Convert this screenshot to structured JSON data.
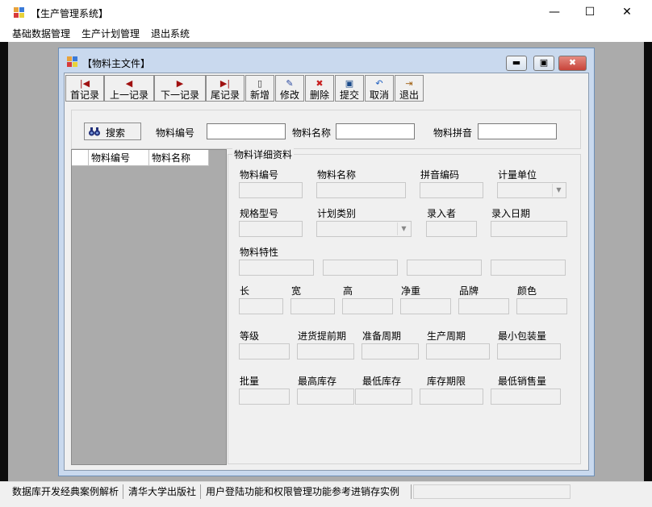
{
  "window": {
    "title": "【生产管理系统】",
    "controls": {
      "minimize": "—",
      "maximize": "☐",
      "close": "✕"
    }
  },
  "menu": [
    {
      "label": "基础数据管理"
    },
    {
      "label": "生产计划管理"
    },
    {
      "label": "退出系统"
    }
  ],
  "child_window": {
    "title": "【物料主文件】",
    "controls": {
      "minimize": "▬",
      "maximize": "▣",
      "close": "✖"
    }
  },
  "toolbar": [
    {
      "label": "首记录",
      "icon": "first-record-icon",
      "glyph": "|◀"
    },
    {
      "label": "上一记录",
      "icon": "prev-record-icon",
      "glyph": "◀"
    },
    {
      "label": "下一记录",
      "icon": "next-record-icon",
      "glyph": "▶"
    },
    {
      "label": "尾记录",
      "icon": "last-record-icon",
      "glyph": "▶|"
    },
    {
      "label": "新增",
      "icon": "new-document-icon",
      "glyph": "▯"
    },
    {
      "label": "修改",
      "icon": "edit-icon",
      "glyph": "✎"
    },
    {
      "label": "删除",
      "icon": "delete-icon",
      "glyph": "✖"
    },
    {
      "label": "提交",
      "icon": "save-disk-icon",
      "glyph": "▣"
    },
    {
      "label": "取消",
      "icon": "undo-icon",
      "glyph": "↶"
    },
    {
      "label": "退出",
      "icon": "exit-door-icon",
      "glyph": "⇥"
    }
  ],
  "search": {
    "button_label": "搜索",
    "code_label": "物料编号",
    "name_label": "物料名称",
    "pinyin_label": "物料拼音",
    "code_value": "",
    "name_value": "",
    "pinyin_value": ""
  },
  "grid": {
    "columns": [
      "物料编号",
      "物料名称"
    ]
  },
  "detail": {
    "legend": "物料详细资料",
    "fields": {
      "code": "物料编号",
      "name": "物料名称",
      "pinyin": "拼音编码",
      "unit": "计量单位",
      "spec": "规格型号",
      "plan_type": "计划类别",
      "entered_by": "录入者",
      "entered_date": "录入日期",
      "property": "物料特性",
      "length": "长",
      "width": "宽",
      "height": "高",
      "net_weight": "净重",
      "brand": "品牌",
      "color": "颜色",
      "grade": "等级",
      "purchase_lead": "进货提前期",
      "prep_cycle": "准备周期",
      "production_cycle": "生产周期",
      "min_pack": "最小包装量",
      "batch": "批量",
      "max_stock": "最高库存",
      "min_stock": "最低库存",
      "stock_limit": "库存期限",
      "min_sales": "最低销售量"
    }
  },
  "status": [
    "数据库开发经典案例解析",
    "清华大学出版社",
    "用户登陆功能和权限管理功能参考进销存实例"
  ],
  "colors": {
    "mdi_background": "#ababab",
    "child_frame": "#c9d9ee",
    "close_button": "#c8443a"
  }
}
